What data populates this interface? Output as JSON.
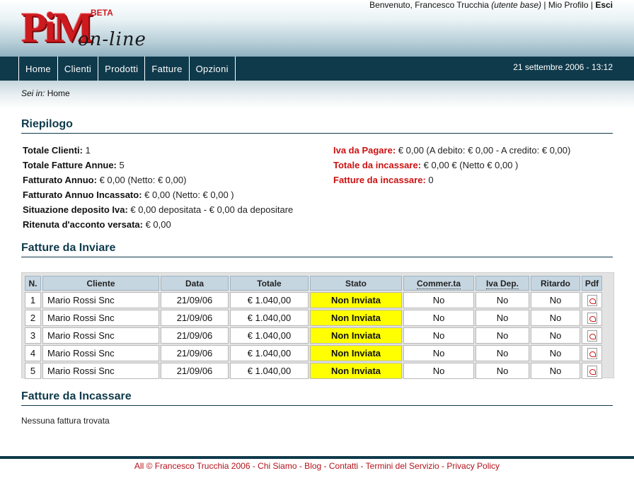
{
  "header": {
    "logo_text": "PiM",
    "logo_subtitle": "on-line",
    "beta": "BETA",
    "welcome": "Benvenuto, Francesco Trucchia",
    "role": "(utente base)",
    "sep1": "|",
    "profile": "Mio Profilo",
    "sep2": "|",
    "logout": "Esci"
  },
  "nav": {
    "items": [
      {
        "label": "Home"
      },
      {
        "label": "Clienti"
      },
      {
        "label": "Prodotti"
      },
      {
        "label": "Fatture"
      },
      {
        "label": "Opzioni"
      }
    ],
    "datetime": "21 settembre 2006 - 13:12"
  },
  "breadcrumb": {
    "prefix": "Sei in:",
    "current": "Home"
  },
  "summary": {
    "title": "Riepilogo",
    "left": [
      {
        "label": "Totale Clienti:",
        "value": "1"
      },
      {
        "label": "Totale Fatture Annue:",
        "value": "5"
      },
      {
        "label": "Fatturato Annuo:",
        "value": "€ 0,00 (Netto: € 0,00)"
      },
      {
        "label": "Fatturato Annuo Incassato:",
        "value": "€ 0,00 (Netto: € 0,00 )"
      },
      {
        "label": "Situazione deposito Iva:",
        "value": "€ 0,00 depositata - € 0,00 da depositare"
      },
      {
        "label": "Ritenuta d'acconto versata:",
        "value": "€ 0,00"
      }
    ],
    "right": [
      {
        "label": "Iva da Pagare:",
        "value": "€ 0,00 (A debito: € 0,00 - A credito: € 0,00)"
      },
      {
        "label": "Totale da incassare:",
        "value": "€ 0,00 € (Netto € 0,00 )"
      },
      {
        "label": "Fatture da incassare:",
        "value": "0"
      }
    ]
  },
  "to_send": {
    "title": "Fatture da Inviare",
    "columns": [
      "N.",
      "Cliente",
      "Data",
      "Totale",
      "Stato",
      "Commer.ta",
      "Iva Dep.",
      "Ritardo",
      "Pdf"
    ],
    "rows": [
      {
        "n": "1",
        "client": "Mario Rossi Snc",
        "date": "21/09/06",
        "total": "€ 1.040,00",
        "status": "Non Inviata",
        "commercial": "No",
        "iva": "No",
        "delay": "No",
        "pdf": "pdf-icon"
      },
      {
        "n": "2",
        "client": "Mario Rossi Snc",
        "date": "21/09/06",
        "total": "€ 1.040,00",
        "status": "Non Inviata",
        "commercial": "No",
        "iva": "No",
        "delay": "No",
        "pdf": "pdf-icon"
      },
      {
        "n": "3",
        "client": "Mario Rossi Snc",
        "date": "21/09/06",
        "total": "€ 1.040,00",
        "status": "Non Inviata",
        "commercial": "No",
        "iva": "No",
        "delay": "No",
        "pdf": "pdf-icon"
      },
      {
        "n": "4",
        "client": "Mario Rossi Snc",
        "date": "21/09/06",
        "total": "€ 1.040,00",
        "status": "Non Inviata",
        "commercial": "No",
        "iva": "No",
        "delay": "No",
        "pdf": "pdf-icon"
      },
      {
        "n": "5",
        "client": "Mario Rossi Snc",
        "date": "21/09/06",
        "total": "€ 1.040,00",
        "status": "Non Inviata",
        "commercial": "No",
        "iva": "No",
        "delay": "No",
        "pdf": "pdf-icon"
      }
    ]
  },
  "to_collect": {
    "title": "Fatture da Incassare",
    "empty": "Nessuna fattura trovata"
  },
  "footer": {
    "text": "All © Francesco Trucchia 2006 - Chi Siamo - Blog - Contatti - Termini del Servizio - Privacy Policy"
  },
  "colors": {
    "nav_bg": "#0f3a4b",
    "brand_red": "#cc1a1f",
    "status_yellow": "#ffff00",
    "alert_red": "#cc1111"
  }
}
